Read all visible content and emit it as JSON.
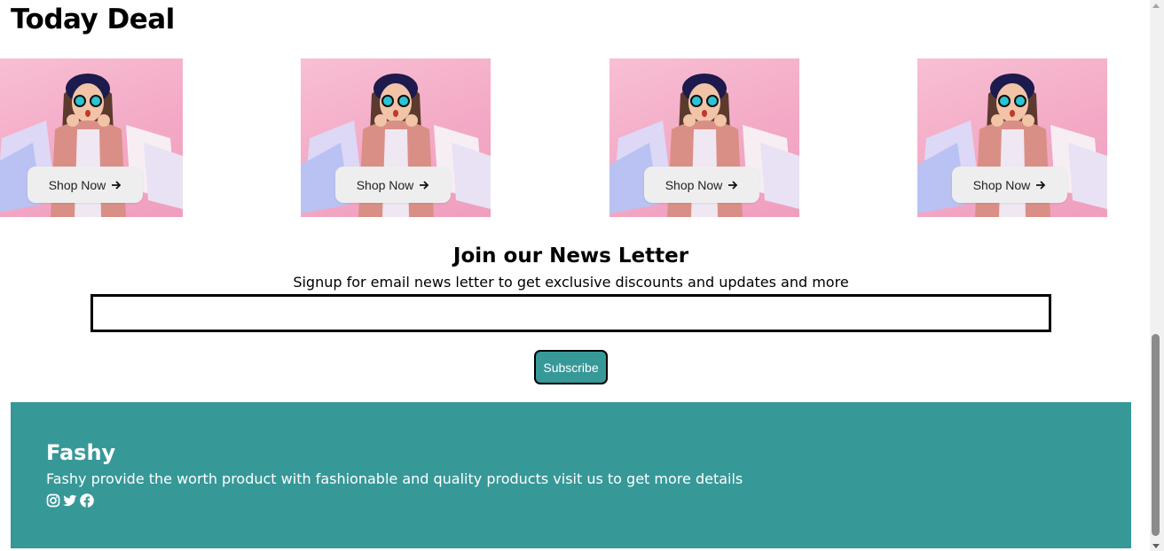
{
  "deals": {
    "title": "Today Deal",
    "cards": [
      {
        "button_label": "Shop Now"
      },
      {
        "button_label": "Shop Now"
      },
      {
        "button_label": "Shop Now"
      },
      {
        "button_label": "Shop Now"
      }
    ]
  },
  "newsletter": {
    "title": "Join our News Letter",
    "subtitle": "Signup for email news letter to get exclusive discounts and updates and more",
    "email_value": "",
    "subscribe_label": "Subscribe"
  },
  "footer": {
    "brand": "Fashy",
    "description": "Fashy provide the worth product with fashionable and quality products visit us to get more details",
    "social_icons": [
      "instagram-icon",
      "twitter-icon",
      "facebook-icon"
    ],
    "background_color": "#379898"
  },
  "colors": {
    "accent": "#379898",
    "card_background": "#f3a9c5",
    "shop_button": "#eeeeee"
  }
}
